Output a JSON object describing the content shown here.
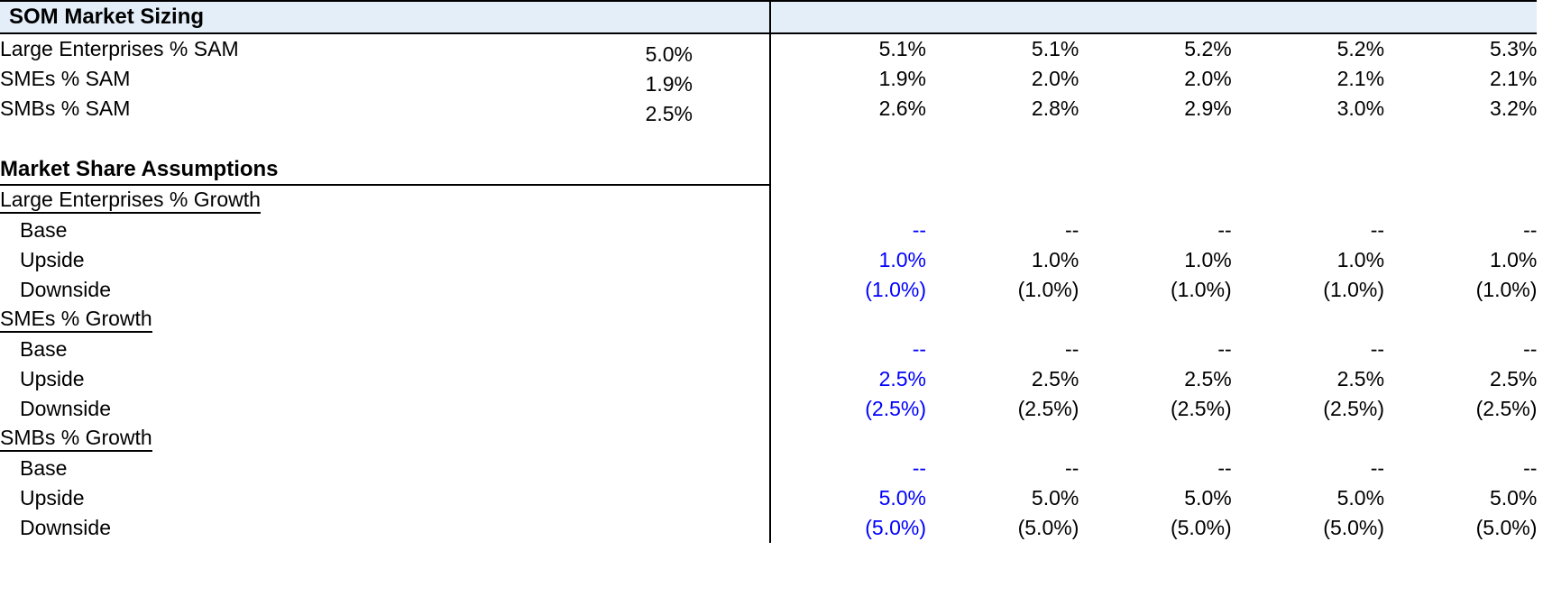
{
  "sheet": {
    "colors": {
      "input_blue": "#0000ff",
      "formula_black": "#000000",
      "header_band_fill": "#e4eef8",
      "border": "#000000"
    }
  },
  "som_section": {
    "title": "SOM Market Sizing",
    "rows": [
      {
        "label": "Large Enterprises % SAM",
        "first_value": "5.0%",
        "values": [
          "5.1%",
          "5.1%",
          "5.2%",
          "5.2%",
          "5.3%"
        ]
      },
      {
        "label": "SMEs % SAM",
        "first_value": "1.9%",
        "values": [
          "1.9%",
          "2.0%",
          "2.0%",
          "2.1%",
          "2.1%"
        ]
      },
      {
        "label": "SMBs % SAM",
        "first_value": "2.5%",
        "values": [
          "2.6%",
          "2.8%",
          "2.9%",
          "3.0%",
          "3.2%"
        ]
      }
    ]
  },
  "assumptions_section": {
    "title": "Market Share Assumptions",
    "groups": [
      {
        "heading": "Large Enterprises % Growth",
        "rows": [
          {
            "label": "Base",
            "values": [
              "--",
              "--",
              "--",
              "--",
              "--"
            ]
          },
          {
            "label": "Upside",
            "values": [
              "1.0%",
              "1.0%",
              "1.0%",
              "1.0%",
              "1.0%"
            ]
          },
          {
            "label": "Downside",
            "values": [
              "(1.0%)",
              "(1.0%)",
              "(1.0%)",
              "(1.0%)",
              "(1.0%)"
            ]
          }
        ]
      },
      {
        "heading": "SMEs % Growth",
        "rows": [
          {
            "label": "Base",
            "values": [
              "--",
              "--",
              "--",
              "--",
              "--"
            ]
          },
          {
            "label": "Upside",
            "values": [
              "2.5%",
              "2.5%",
              "2.5%",
              "2.5%",
              "2.5%"
            ]
          },
          {
            "label": "Downside",
            "values": [
              "(2.5%)",
              "(2.5%)",
              "(2.5%)",
              "(2.5%)",
              "(2.5%)"
            ]
          }
        ]
      },
      {
        "heading": "SMBs % Growth",
        "rows": [
          {
            "label": "Base",
            "values": [
              "--",
              "--",
              "--",
              "--",
              "--"
            ]
          },
          {
            "label": "Upside",
            "values": [
              "5.0%",
              "5.0%",
              "5.0%",
              "5.0%",
              "5.0%"
            ]
          },
          {
            "label": "Downside",
            "values": [
              "(5.0%)",
              "(5.0%)",
              "(5.0%)",
              "(5.0%)",
              "(5.0%)"
            ]
          }
        ]
      }
    ]
  }
}
